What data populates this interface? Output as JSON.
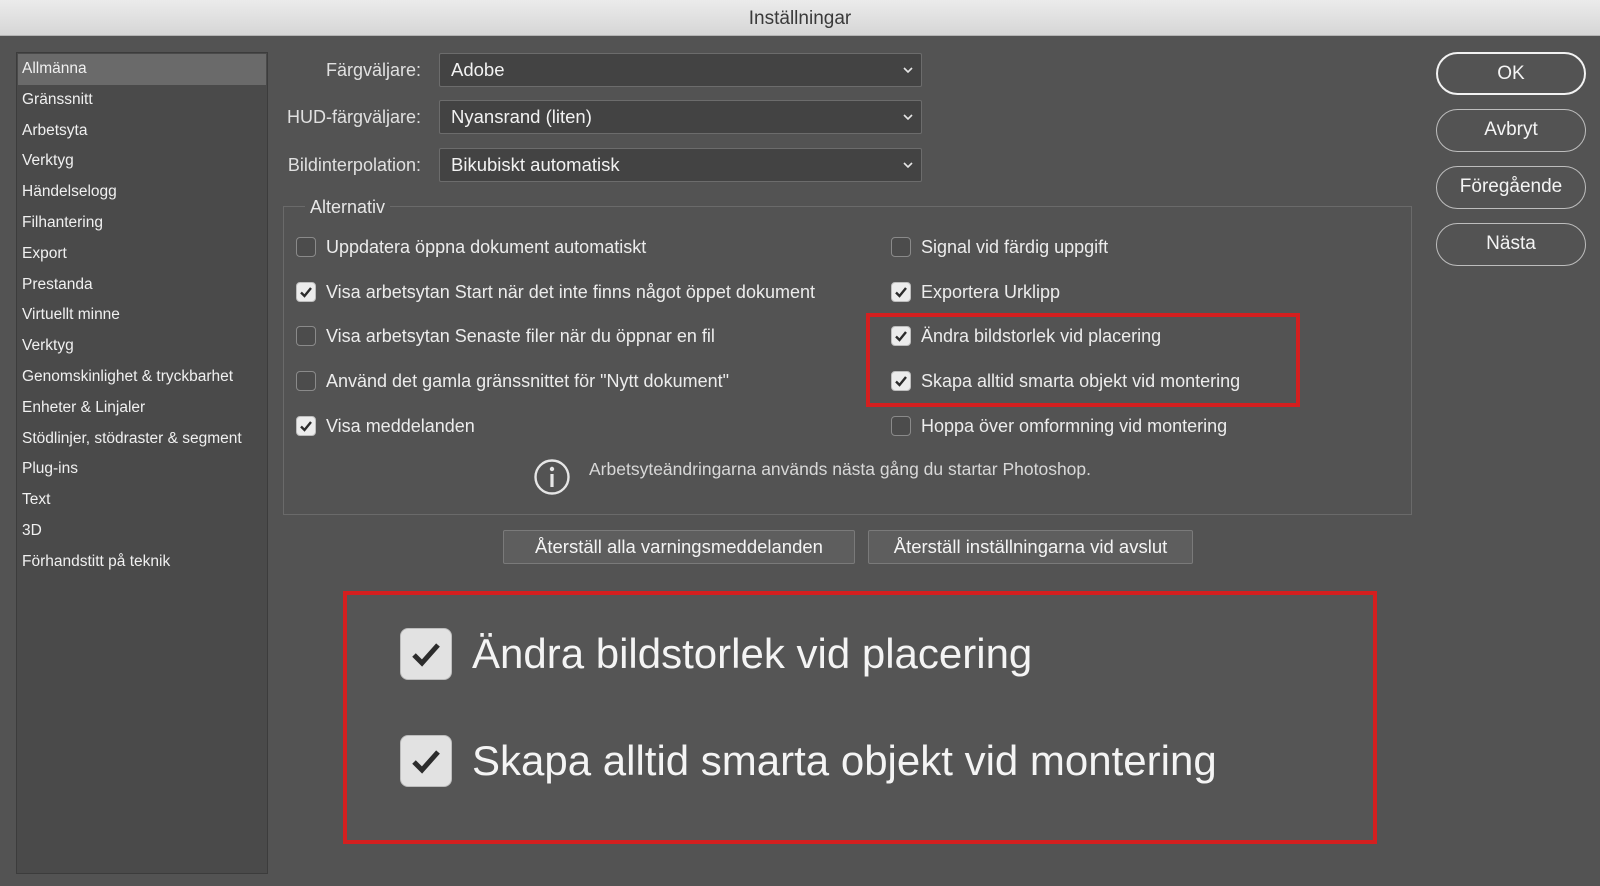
{
  "window": {
    "title": "Inställningar"
  },
  "sidebar": {
    "items": [
      {
        "label": "Allmänna",
        "selected": true
      },
      {
        "label": "Gränssnitt"
      },
      {
        "label": "Arbetsyta"
      },
      {
        "label": "Verktyg"
      },
      {
        "label": "Händelselogg"
      },
      {
        "label": "Filhantering"
      },
      {
        "label": "Export"
      },
      {
        "label": "Prestanda"
      },
      {
        "label": "Virtuellt minne"
      },
      {
        "label": "Verktyg"
      },
      {
        "label": "Genomskinlighet & tryckbarhet"
      },
      {
        "label": "Enheter & Linjaler"
      },
      {
        "label": "Stödlinjer, stödraster & segment"
      },
      {
        "label": "Plug-ins"
      },
      {
        "label": "Text"
      },
      {
        "label": "3D"
      },
      {
        "label": "Förhandstitt på teknik"
      }
    ]
  },
  "settings": {
    "color_picker": {
      "label": "Färgväljare:",
      "value": "Adobe"
    },
    "hud_color_picker": {
      "label": "HUD-färgväljare:",
      "value": "Nyansrand (liten)"
    },
    "interpolation": {
      "label": "Bildinterpolation:",
      "value": "Bikubiskt automatisk"
    }
  },
  "options": {
    "title": "Alternativ",
    "left": [
      {
        "label": "Uppdatera öppna dokument automatiskt",
        "checked": false
      },
      {
        "label": "Visa arbetsytan Start när det inte finns något öppet dokument",
        "checked": true
      },
      {
        "label": "Visa arbetsytan Senaste filer när du öppnar en fil",
        "checked": false
      },
      {
        "label": "Använd det gamla gränssnittet för \"Nytt dokument\"",
        "checked": false
      },
      {
        "label": "Visa meddelanden",
        "checked": true
      }
    ],
    "right": [
      {
        "label": "Signal vid färdig uppgift",
        "checked": false
      },
      {
        "label": "Exportera Urklipp",
        "checked": true
      },
      {
        "label": "Ändra bildstorlek vid placering",
        "checked": true
      },
      {
        "label": "Skapa alltid smarta objekt vid montering",
        "checked": true
      },
      {
        "label": "Hoppa över omformning vid montering",
        "checked": false
      }
    ],
    "info": "Arbetsyteändringarna används nästa gång du startar Photoshop."
  },
  "reset_buttons": {
    "warnings": "Återställ alla varningsmeddelanden",
    "on_quit": "Återställ inställningarna vid avslut"
  },
  "dialog_buttons": {
    "ok": "OK",
    "cancel": "Avbryt",
    "prev": "Föregående",
    "next": "Nästa"
  },
  "callout": {
    "items": [
      {
        "label": "Ändra bildstorlek vid placering",
        "checked": true
      },
      {
        "label": "Skapa alltid smarta objekt vid montering",
        "checked": true
      }
    ]
  },
  "colors": {
    "background": "#535353",
    "highlight": "#d41f1f"
  }
}
